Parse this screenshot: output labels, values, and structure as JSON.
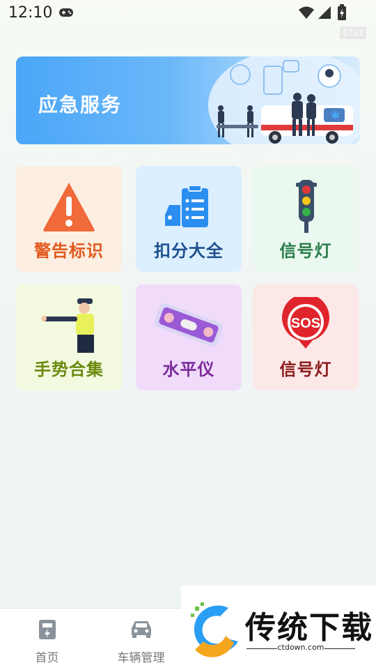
{
  "status_bar": {
    "time": "12:10",
    "tag": "67s3"
  },
  "banner": {
    "title": "应急服务"
  },
  "tiles": [
    {
      "label": "警告标识",
      "bg": "#fdeee2",
      "color": "#e05a1e"
    },
    {
      "label": "扣分大全",
      "bg": "#dcefff",
      "color": "#1c4f8c"
    },
    {
      "label": "信号灯",
      "bg": "#eaf8ef",
      "color": "#2a7d4b"
    },
    {
      "label": "手势合集",
      "bg": "#f3fae0",
      "color": "#6a8a10"
    },
    {
      "label": "水平仪",
      "bg": "#f1dbfb",
      "color": "#7a2b9a"
    },
    {
      "label": "信号灯",
      "bg": "#fde8e8",
      "color": "#8a1b1b"
    }
  ],
  "nav": [
    {
      "label": "首页",
      "icon": "home-fuel-icon"
    },
    {
      "label": "车辆管理",
      "icon": "car-icon"
    }
  ],
  "watermark": {
    "text": "传统下载",
    "domain": "ctdown.com"
  }
}
